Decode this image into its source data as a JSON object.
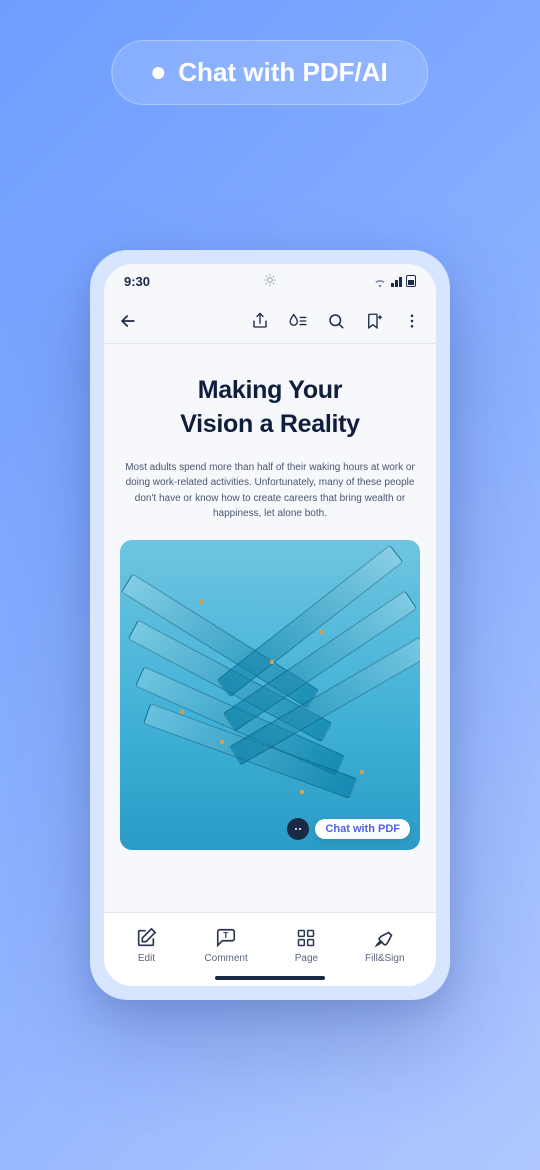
{
  "promo": {
    "label": "Chat with PDF/AI"
  },
  "statusBar": {
    "time": "9:30"
  },
  "toolbar": {
    "icons": {
      "back": "back-arrow-icon",
      "share": "share-icon",
      "ink": "ink-drop-icon",
      "search": "search-icon",
      "bookmark": "bookmark-icon",
      "more": "more-vertical-icon"
    }
  },
  "document": {
    "titleLine1": "Making Your",
    "titleLine2": "Vision a Reality",
    "body": "Most adults spend more than half of their waking hours at work or doing work-related activities. Unfortunately, many of these people don't have or know how to create careers that bring wealth or happiness, let alone both."
  },
  "chatBadge": {
    "label": "Chat with PDF"
  },
  "bottomNav": {
    "items": [
      {
        "label": "Edit",
        "icon": "edit-icon"
      },
      {
        "label": "Comment",
        "icon": "comment-icon"
      },
      {
        "label": "Page",
        "icon": "page-grid-icon"
      },
      {
        "label": "Fill&Sign",
        "icon": "fill-sign-icon"
      }
    ]
  },
  "colors": {
    "accent": "#4f5fe8",
    "text_dark": "#1a2a44"
  }
}
